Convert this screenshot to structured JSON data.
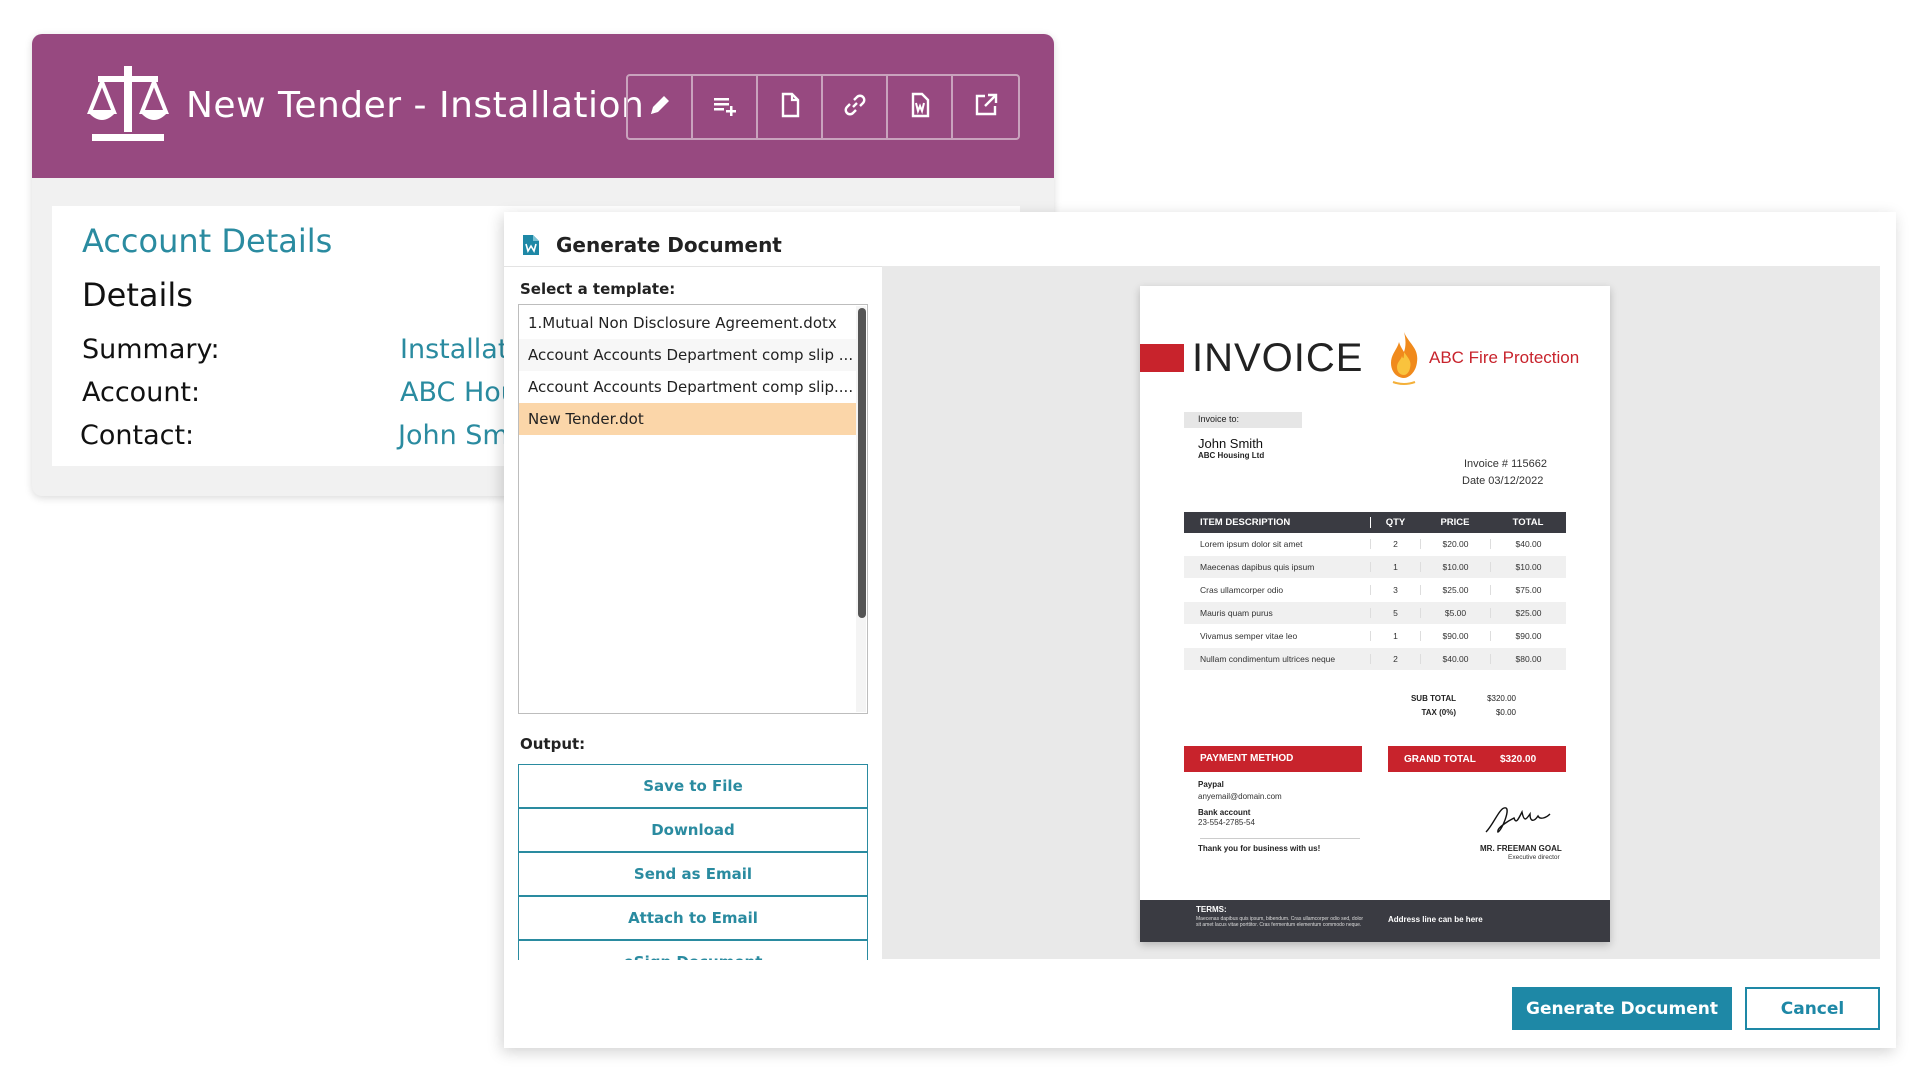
{
  "tender": {
    "title": "New Tender - Installation",
    "toolbar": [
      {
        "icon": "pencil-icon",
        "name": "edit"
      },
      {
        "icon": "add-list-icon",
        "name": "add-to-list"
      },
      {
        "icon": "document-icon",
        "name": "document"
      },
      {
        "icon": "link-icon",
        "name": "link"
      },
      {
        "icon": "word-document-icon",
        "name": "generate-document"
      },
      {
        "icon": "external-link-icon",
        "name": "open-external"
      }
    ],
    "accent_color": "#974980"
  },
  "account": {
    "section_title": "Account Details",
    "details_heading": "Details",
    "summary_label": "Summary:",
    "summary_value": "Installat",
    "account_label": "Account:",
    "account_value": "ABC Hou",
    "contact_label": "Contact:",
    "contact_value": "John Sm"
  },
  "dialog": {
    "title": "Generate Document",
    "select_label": "Select a template:",
    "templates": [
      "1.Mutual Non Disclosure Agreement.dotx",
      "Account Accounts Department comp slip ...",
      "Account Accounts Department comp slip....",
      "New Tender.dot"
    ],
    "selected_template": "New Tender.dot",
    "output_label": "Output:",
    "outputs": [
      "Save to File",
      "Download",
      "Send as Email",
      "Attach to Email",
      "eSign Document"
    ],
    "generate_label": "Generate Document",
    "cancel_label": "Cancel",
    "accent_color": "#1e88a6",
    "selection_color": "#fbd6a9"
  },
  "invoice": {
    "heading": "INVOICE",
    "company": "ABC Fire Protection",
    "invoice_to_label": "Invoice to:",
    "customer_name": "John Smith",
    "customer_company": "ABC Housing Ltd",
    "invoice_number": "Invoice # 115662",
    "invoice_date": "Date 03/12/2022",
    "columns": [
      "ITEM DESCRIPTION",
      "QTY",
      "PRICE",
      "TOTAL"
    ],
    "rows": [
      [
        "Lorem ipsum dolor sit amet",
        "2",
        "$20.00",
        "$40.00"
      ],
      [
        "Maecenas dapibus quis ipsum",
        "1",
        "$10.00",
        "$10.00"
      ],
      [
        "Cras ullamcorper odio",
        "3",
        "$25.00",
        "$75.00"
      ],
      [
        "Mauris quam purus",
        "5",
        "$5.00",
        "$25.00"
      ],
      [
        "Vivamus semper vitae leo",
        "1",
        "$90.00",
        "$90.00"
      ],
      [
        "Nullam condimentum ultrices neque",
        "2",
        "$40.00",
        "$80.00"
      ]
    ],
    "subtotal_label": "SUB TOTAL",
    "subtotal_value": "$320.00",
    "tax_label": "TAX (0%)",
    "tax_value": "$0.00",
    "payment_method_label": "PAYMENT METHOD",
    "grand_total_label": "GRAND TOTAL",
    "grand_total_value": "$320.00",
    "paypal_label": "Paypal",
    "paypal_email": "anyemail@domain.com",
    "bank_label": "Bank account",
    "bank_number": "23-554-2785-54",
    "thanks": "Thank you for business with us!",
    "signer_name": "MR. FREEMAN GOAL",
    "signer_title": "Executive director",
    "terms_label": "TERMS:",
    "terms_text": "Maecenas dapibus quis ipsum, bibendum. Cras ullamcorper odio sed, dolor sit amet lacus vitae porttitor. Cras fermentum elementum commodo neque.",
    "address_line": "Address line can be here",
    "brand_red": "#c8232c"
  }
}
